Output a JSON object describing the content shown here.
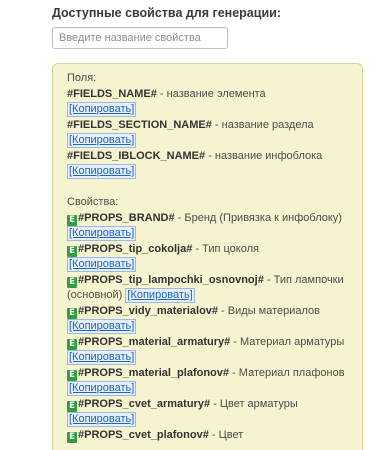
{
  "title": "Доступные свойства для генерации:",
  "search": {
    "placeholder": "Введите название свойства"
  },
  "copy_label": "[Копировать]",
  "badge_label": "E",
  "fields": {
    "heading": "Поля:",
    "items": [
      {
        "code": "#FIELDS_NAME#",
        "desc": " - название элемента"
      },
      {
        "code": "#FIELDS_SECTION_NAME#",
        "desc": " - название раздела"
      },
      {
        "code": "#FIELDS_IBLOCK_NAME#",
        "desc": " - название инфоблока"
      }
    ]
  },
  "properties": {
    "heading": "Свойства:",
    "items": [
      {
        "code": "#PROPS_BRAND#",
        "desc": " - Бренд (Привязка к инфоблоку)"
      },
      {
        "code": "#PROPS_tip_cokolja#",
        "desc": " - Тип цоколя"
      },
      {
        "code": "#PROPS_tip_lampochki_osnovnoj#",
        "desc": " - Тип лампочки (основной)"
      },
      {
        "code": "#PROPS_vidy_materialov#",
        "desc": " - Виды материалов"
      },
      {
        "code": "#PROPS_material_armatury#",
        "desc": " - Материал арматуры"
      },
      {
        "code": "#PROPS_material_plafonov#",
        "desc": " - Материал плафонов"
      },
      {
        "code": "#PROPS_cvet_armatury#",
        "desc": " - Цвет арматуры"
      },
      {
        "code": "#PROPS_cvet_plafonov#",
        "desc": " - Цвет"
      }
    ]
  }
}
